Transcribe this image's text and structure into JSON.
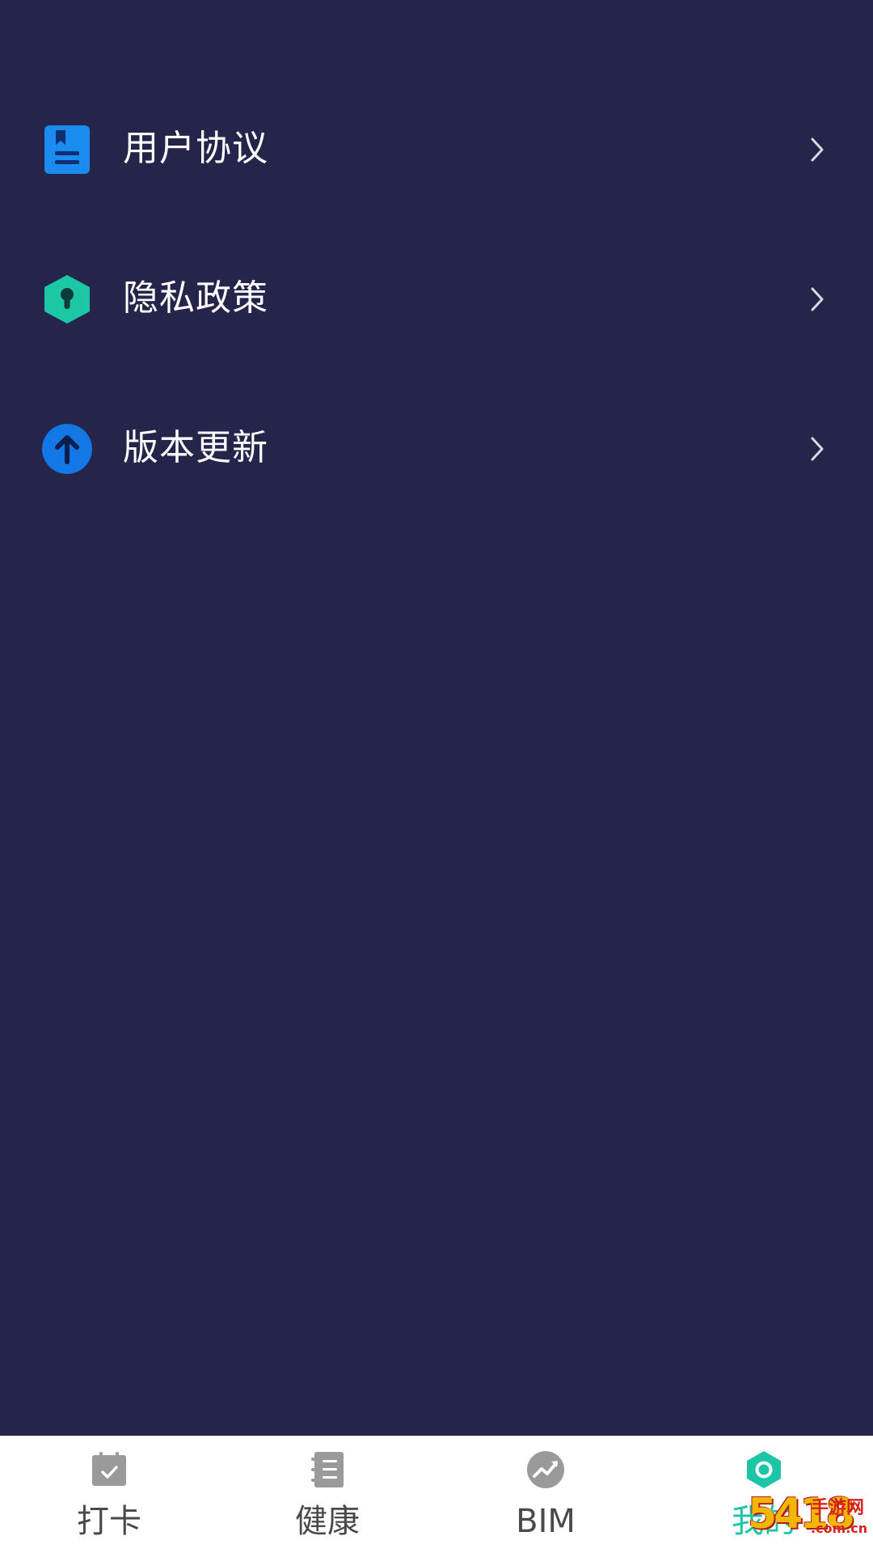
{
  "menu": {
    "items": [
      {
        "label": "用户协议",
        "icon": "document-icon",
        "icon_color": "#1a8cf0"
      },
      {
        "label": "隐私政策",
        "icon": "shield-lock-icon",
        "icon_color": "#1bc7a5"
      },
      {
        "label": "版本更新",
        "icon": "arrow-up-circle-icon",
        "icon_color": "#1477e6"
      }
    ],
    "chevron_icon": "chevron-right-icon"
  },
  "bottom_nav": {
    "items": [
      {
        "label": "打卡",
        "icon": "calendar-check-icon",
        "active": false
      },
      {
        "label": "健康",
        "icon": "notebook-icon",
        "active": false
      },
      {
        "label": "BIM",
        "icon": "trend-chart-icon",
        "active": false
      },
      {
        "label": "我的",
        "icon": "hexagon-icon",
        "active": true
      }
    ],
    "active_color": "#1cc5a6",
    "inactive_color": "#4a4a4a"
  },
  "watermark": {
    "digits": "5418",
    "text": "手游网",
    "domain": ".com.cn"
  },
  "colors": {
    "background": "#25244a",
    "nav_background": "#ffffff",
    "text": "#ffffff"
  }
}
